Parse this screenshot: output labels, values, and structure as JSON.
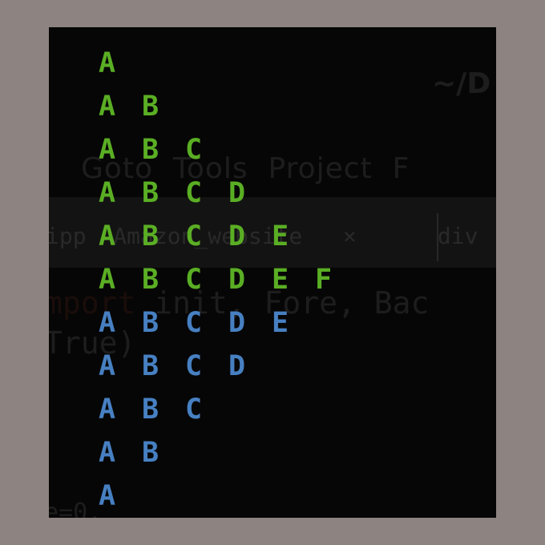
{
  "colors": {
    "background": "#8d8380",
    "terminal": "#060606",
    "green": "#5aae24",
    "blue": "#4780c2"
  },
  "ghost": {
    "path": "~/D",
    "menu": "Goto  Tools  Project  F",
    "tabs": "ipp  Amazon_website   ×      div",
    "code1_kw": "mport",
    "code1": " init, Fore, Bac",
    "code2": "True)",
    "code3": "e=0,"
  },
  "terminal_output": {
    "rows": [
      {
        "color": "green",
        "letters": [
          "A"
        ]
      },
      {
        "color": "green",
        "letters": [
          "A",
          "B"
        ]
      },
      {
        "color": "green",
        "letters": [
          "A",
          "B",
          "C"
        ]
      },
      {
        "color": "green",
        "letters": [
          "A",
          "B",
          "C",
          "D"
        ]
      },
      {
        "color": "green",
        "letters": [
          "A",
          "B",
          "C",
          "D",
          "E"
        ]
      },
      {
        "color": "green",
        "letters": [
          "A",
          "B",
          "C",
          "D",
          "E",
          "F"
        ]
      },
      {
        "color": "blue",
        "letters": [
          "A",
          "B",
          "C",
          "D",
          "E"
        ]
      },
      {
        "color": "blue",
        "letters": [
          "A",
          "B",
          "C",
          "D"
        ]
      },
      {
        "color": "blue",
        "letters": [
          "A",
          "B",
          "C"
        ]
      },
      {
        "color": "blue",
        "letters": [
          "A",
          "B"
        ]
      },
      {
        "color": "blue",
        "letters": [
          "A"
        ]
      }
    ]
  }
}
